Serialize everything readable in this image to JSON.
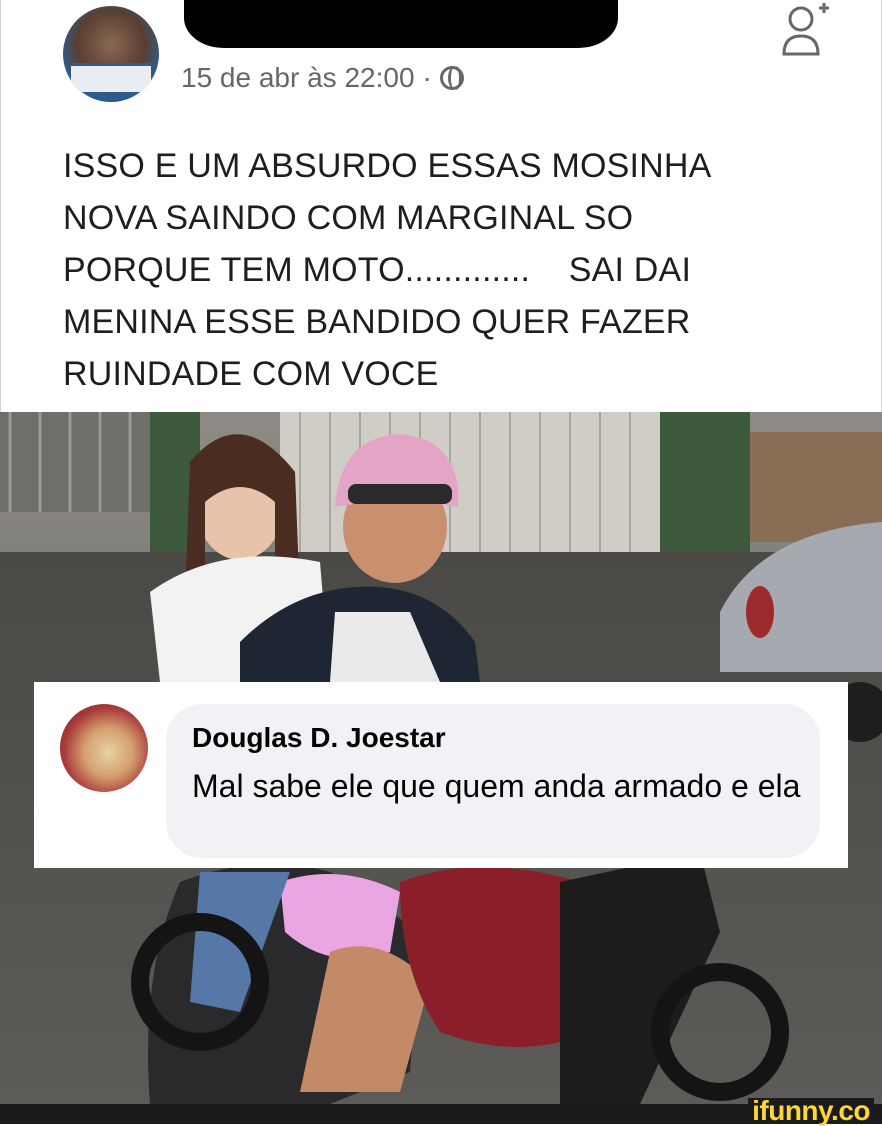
{
  "post": {
    "timestamp": "15 de abr às 22:00",
    "separator": "·",
    "privacy_icon": "globe-icon",
    "add_friend_icon": "add-friend-icon",
    "text": "ISSO E UM ABSURDO ESSAS MOSINHA\nNOVA SAINDO COM MARGINAL SO\nPORQUE TEM MOTO.............    SAI DAI\nMENINA ESSE BANDIDO QUER FAZER\nRUINDADE COM VOCE"
  },
  "comment": {
    "author": "Douglas D. Joestar",
    "text": "Mal sabe ele que quem anda armado e ela"
  },
  "watermark": {
    "label": "ifunny.co"
  },
  "colors": {
    "text_primary": "#1c1e21",
    "text_secondary": "#65676b",
    "bubble_bg": "#f0f2f5",
    "watermark": "#ffd633"
  }
}
